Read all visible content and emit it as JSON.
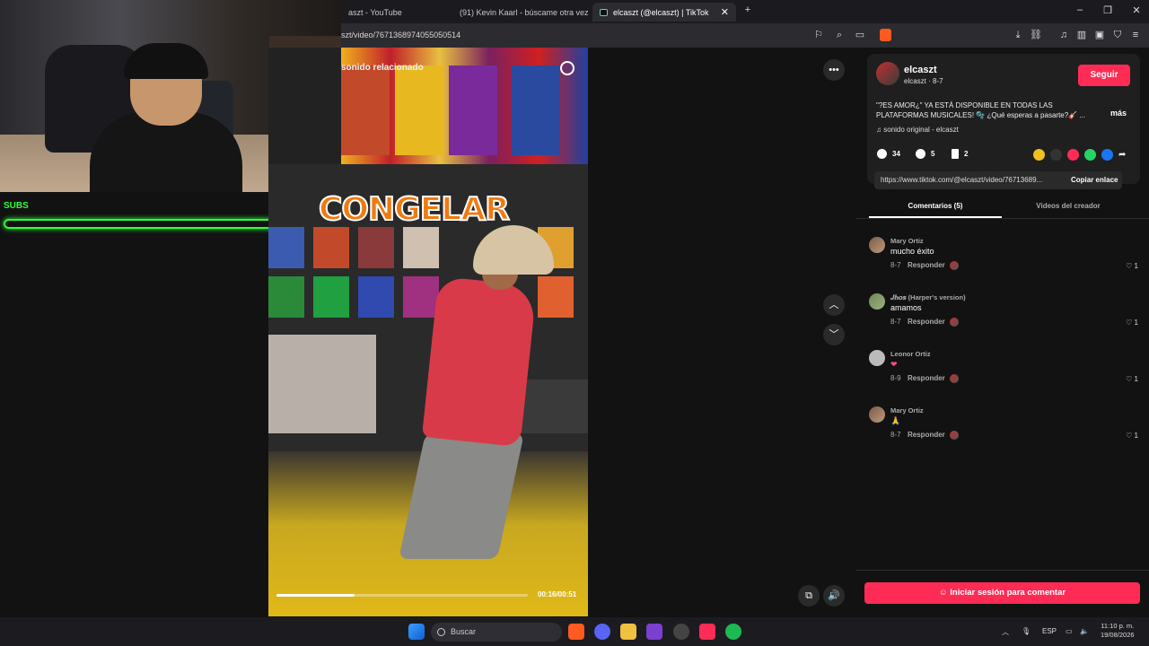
{
  "browser": {
    "tabs": [
      {
        "label": "aszt - YouTube",
        "active": false
      },
      {
        "label": "(91) Kevin Kaarl - búscame otra vez (",
        "active": false
      },
      {
        "label": "elcaszt (@elcaszt) | TikTok",
        "active": true
      }
    ],
    "url": "szt/video/7671368974055050514",
    "new_tab_icon": "plus-icon"
  },
  "overlay": {
    "subs_label": "SUBS",
    "subs_progress": 0.0
  },
  "video": {
    "search_label": "sonido relacionado",
    "caption": "CONGELAR",
    "time": "00:16/00:51",
    "progress": 0.31
  },
  "post": {
    "author_name": "elcaszt",
    "author_handle": "elcaszt · 8-7",
    "follow_label": "Seguir",
    "description": "\"?ES AMOR¿\" YA ESTÁ DISPONIBLE EN TODAS LAS PLATAFORMAS MUSICALES! 🫧 ¿Qué esperas a pasarte?🎸 ...",
    "more_label": "más",
    "sound": "sonido original - elcaszt",
    "likes": "34",
    "comments": "5",
    "saves": "2",
    "link": "https://www.tiktok.com/@elcaszt/video/76713689...",
    "copy_label": "Copiar enlace"
  },
  "panel_tabs": {
    "comments": "Comentarios (5)",
    "creator_videos": "Videos del creador"
  },
  "comments": [
    {
      "name": "Mary Ortiz",
      "text": "mucho éxito",
      "date": "8-7",
      "reply": "Responder",
      "likes": "1"
    },
    {
      "name": "𝑱𝒉𝒐𝒔 (Harper's version)",
      "text": "amamos",
      "date": "8-7",
      "reply": "Responder",
      "likes": "1"
    },
    {
      "name": "Leonor Ortiz",
      "text": "❤",
      "date": "8-9",
      "reply": "Responder",
      "likes": "1"
    },
    {
      "name": "Mary Ortiz",
      "text": "🙏",
      "date": "8-7",
      "reply": "Responder",
      "likes": "1"
    }
  ],
  "login_label": "Iniciar sesión para comentar",
  "taskbar": {
    "search_placeholder": "Buscar",
    "lang": "ESP",
    "time": "11:10 p. m.",
    "date": "19/08/2026"
  },
  "colors": {
    "accent": "#fe2c55",
    "subs_green": "#2fff3a"
  }
}
